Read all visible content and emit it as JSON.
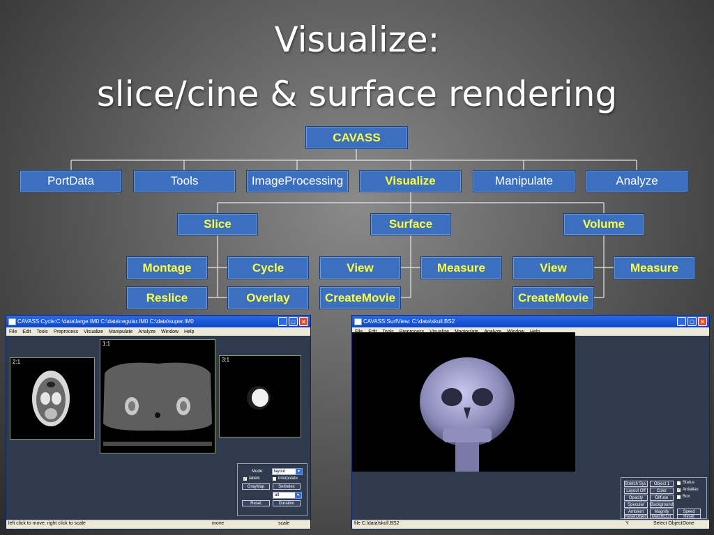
{
  "title": {
    "line1": "Visualize:",
    "line2": "slice/cine & surface rendering"
  },
  "tree": {
    "root": "CAVASS",
    "level1": [
      "PortData",
      "Tools",
      "ImageProcessing",
      "Visualize",
      "Manipulate",
      "Analyze"
    ],
    "level2": [
      "Slice",
      "Surface",
      "Volume"
    ],
    "slice_children": [
      "Montage",
      "Cycle",
      "Reslice",
      "Overlay"
    ],
    "surface_children": [
      "View",
      "Measure",
      "CreateMovie"
    ],
    "volume_children": [
      "View",
      "Measure",
      "CreateMovie"
    ]
  },
  "colors": {
    "node_bg": "#3b6fc0",
    "highlight_text": "#ffff3a",
    "normal_text": "#ffffff"
  },
  "cycle_window": {
    "title": "CAVASS:Cycle:C:\\data\\large.IM0 C:\\data\\regular.IM0 C:\\data\\super.IM0",
    "menu": [
      "File",
      "Edit",
      "Tools",
      "Preprocess",
      "Visualize",
      "Manipulate",
      "Analyze",
      "Window",
      "Help"
    ],
    "views": [
      "2:1",
      "1:1",
      "3:1"
    ],
    "mode_label": "Mode:",
    "mode_value": "layout",
    "labels_label": "labels",
    "interpolate_label": "interpolate",
    "graymap_button": "GrayMap",
    "setindex_button": "SetIndex",
    "all_value": "all",
    "reset_button": "Reset",
    "duration_button": "Duration",
    "status": {
      "left": "left click to move; right click to scale",
      "middle": "move",
      "right": "scale"
    }
  },
  "surf_window": {
    "title": "CAVASS:SurfView: C:\\data\\skull.BS2",
    "menu": [
      "File",
      "Edit",
      "Tools",
      "Preprocess",
      "Visualize",
      "Manipulate",
      "Analyze",
      "Window",
      "Help"
    ],
    "buttons": [
      [
        "Stretch Sys 1",
        "Object 1"
      ],
      [
        "Layout Off",
        "Color"
      ],
      [
        "Opacity",
        "Diffuse"
      ],
      [
        "Specular",
        "Background"
      ],
      [
        "Ambient",
        "Magnify"
      ],
      [
        "ResetObject",
        "MatchEO1"
      ]
    ],
    "extra_buttons": [
      "Speed",
      "Reset"
    ],
    "checks": [
      "Status",
      "Antialias",
      "Box"
    ],
    "status": {
      "left": "file C:\\data\\skull.BS2",
      "y": "Y",
      "select": "Select Object",
      "done": "Done"
    }
  }
}
